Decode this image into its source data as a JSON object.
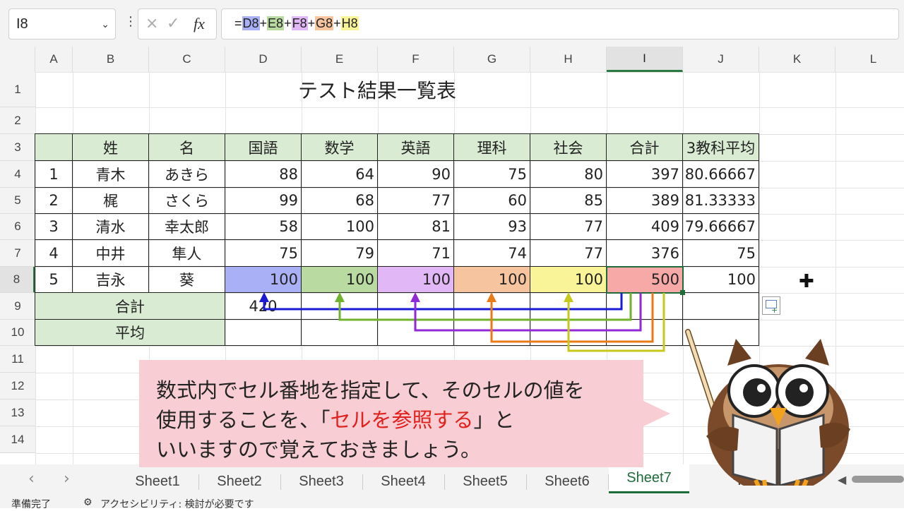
{
  "formula_bar": {
    "name_box": "I8",
    "cancel_icon": "×",
    "enter_icon": "✓",
    "fx_label": "fx",
    "formula_parts": [
      {
        "text": "=",
        "color": null
      },
      {
        "text": "D8",
        "color": "#aab0f5"
      },
      {
        "text": "+",
        "color": null
      },
      {
        "text": "E8",
        "color": "#b9dba1"
      },
      {
        "text": "+",
        "color": null
      },
      {
        "text": "F8",
        "color": "#e1b7f6"
      },
      {
        "text": "+",
        "color": null
      },
      {
        "text": "G8",
        "color": "#f6c59f"
      },
      {
        "text": "+",
        "color": null
      },
      {
        "text": "H8",
        "color": "#f9f497"
      }
    ]
  },
  "columns": [
    "A",
    "B",
    "C",
    "D",
    "E",
    "F",
    "G",
    "H",
    "I",
    "J",
    "K",
    "L"
  ],
  "rows": [
    "1",
    "2",
    "3",
    "4",
    "5",
    "6",
    "7",
    "8",
    "9",
    "10",
    "11",
    "12",
    "13",
    "14"
  ],
  "title": "テスト結果一覧表",
  "headers": [
    "姓",
    "名",
    "国語",
    "数学",
    "英語",
    "理科",
    "社会",
    "合計",
    "3教科平均"
  ],
  "students": [
    {
      "no": "1",
      "sei": "青木",
      "mei": "あきら",
      "kokugo": "88",
      "sugaku": "64",
      "eigo": "90",
      "rika": "75",
      "shakai": "80",
      "total": "397",
      "avg": "80.66667"
    },
    {
      "no": "2",
      "sei": "梶",
      "mei": "さくら",
      "kokugo": "99",
      "sugaku": "68",
      "eigo": "77",
      "rika": "60",
      "shakai": "85",
      "total": "389",
      "avg": "81.33333"
    },
    {
      "no": "3",
      "sei": "清水",
      "mei": "幸太郎",
      "kokugo": "58",
      "sugaku": "100",
      "eigo": "81",
      "rika": "93",
      "shakai": "77",
      "total": "409",
      "avg": "79.66667"
    },
    {
      "no": "4",
      "sei": "中井",
      "mei": "隼人",
      "kokugo": "75",
      "sugaku": "79",
      "eigo": "71",
      "rika": "74",
      "shakai": "77",
      "total": "376",
      "avg": "75"
    },
    {
      "no": "5",
      "sei": "吉永",
      "mei": "葵",
      "kokugo": "100",
      "sugaku": "100",
      "eigo": "100",
      "rika": "100",
      "shakai": "100",
      "total": "500",
      "avg": "100"
    }
  ],
  "footer_rows": {
    "total_label": "合計",
    "avg_label": "平均",
    "partial_value": "420"
  },
  "highlight_colors": {
    "D": "#aab0f5",
    "E": "#b9dba1",
    "F": "#e1b7f6",
    "G": "#f6c59f",
    "H": "#f9f497",
    "I": "#f7a9a8",
    "header": "#d9ecd3"
  },
  "arrow_colors": {
    "D": "#1a1ad6",
    "E": "#72b32e",
    "F": "#8f2ad6",
    "G": "#ea7a16",
    "H": "#c8c81a"
  },
  "callout": {
    "line1": "数式内でセル番地を指定して、そのセルの値を",
    "line2_prefix": "使用することを、「",
    "line2_highlight": "セルを参照する",
    "line2_suffix": "」と",
    "line3": "いいますので覚えておきましょう。",
    "highlight_color": "#e0211c"
  },
  "sheet_tabs": [
    "Sheet1",
    "Sheet2",
    "Sheet3",
    "Sheet4",
    "Sheet5",
    "Sheet6",
    "Sheet7"
  ],
  "active_sheet": "Sheet7",
  "status": {
    "ready": "準備完了",
    "accessibility": "アクセシビリティ: 検討が必要です"
  }
}
